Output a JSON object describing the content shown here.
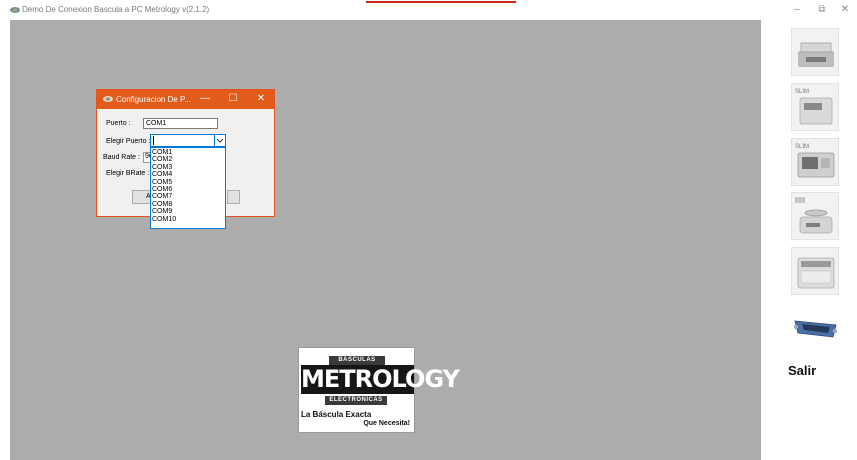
{
  "window": {
    "title": "Demo De Conexion Bascula a PC Metrology v(2.1.2)",
    "minimize_glyph": "–",
    "maximize_glyph": "⧉",
    "close_glyph": "✕"
  },
  "dialog": {
    "title": "Configuracion De P...",
    "minimize_glyph": "—",
    "maximize_glyph": "☐",
    "close_glyph": "✕",
    "puerto_label": "Puerto :",
    "puerto_value": "COM1",
    "elegir_puerto_label": "Elegir Puerto :",
    "baud_rate_label": "Baud Rate :",
    "baud_rate_value_partial": "96",
    "elegir_brate_label": "Elegir BRate :",
    "accept_button_partial": "A"
  },
  "port_dropdown": {
    "options": [
      "COM1",
      "COM2",
      "COM3",
      "COM4",
      "COM5",
      "COM6",
      "COM7",
      "COM8",
      "COM9",
      "COM10"
    ]
  },
  "logo": {
    "top": "BÁSCULAS",
    "main": "METROLOGY",
    "sub": "ELECTRÓNICAS",
    "tagline_1": "La Báscula Exacta",
    "tagline_2": "Que Necesita!"
  },
  "right_panel": {
    "tools": [
      {
        "icon": "scale-icon"
      },
      {
        "icon": "indicator-icon",
        "badge": "SLIM"
      },
      {
        "icon": "indicator-icon",
        "badge": "SLIM"
      },
      {
        "icon": "balance-icon"
      },
      {
        "icon": "price-scale-icon"
      },
      {
        "icon": "serial-port-icon"
      }
    ],
    "exit_label": "Salir"
  },
  "colors": {
    "titlebar_accent": "#cc2a1a",
    "dialog_title": "#e35b1b",
    "mdi_background": "#acacac",
    "focus_blue": "#0078d7"
  }
}
